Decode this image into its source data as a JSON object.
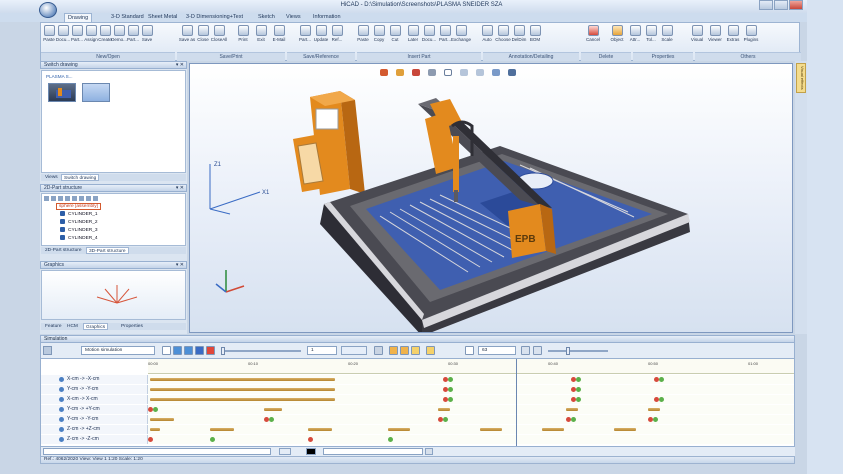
{
  "app": {
    "title": "HiCAD - D:\\Simulation\\Screenshots\\PLASMA SNEIDER SZA",
    "logo_label": "HiCAD"
  },
  "ribbon": {
    "tabs": [
      "Drawing",
      "3-D Standard",
      "Sheet Metal",
      "3-D Dimensioning+Text",
      "Sketch",
      "Views",
      "Information"
    ],
    "active_tab": "Drawing",
    "buttons": [
      "Paste",
      "Docu...",
      "Part...",
      "Assign",
      "Create",
      "Demo...",
      "Part...",
      "Save",
      "Save as",
      "Close",
      "CloseAll",
      "Print",
      "Exit",
      "E-Mail",
      "Part...",
      "Update",
      "Ref...",
      "Paste",
      "Copy",
      "Cut",
      "Later",
      "Docu...",
      "Part...",
      "Exchange",
      "Auto",
      "Choose",
      "DelDim",
      "BOM",
      "Cancel",
      "Object",
      "Attr...",
      "Tol...",
      "Scale",
      "Visual",
      "Viewer",
      "Extras",
      "Plugins"
    ],
    "groups": [
      "New/Open",
      "Save/Print",
      "Save/Reference",
      "Insert Part",
      "Annotation/Detailing",
      "Delete",
      "Properties",
      "Others"
    ]
  },
  "left_panel": {
    "switch_drawing": {
      "header": "Switch drawing",
      "thumb_label": "PLASMA S...",
      "tabs": [
        "Views",
        "Switch drawing"
      ],
      "active_tab": "Switch drawing"
    },
    "part_structure": {
      "header": "2D-Part structure",
      "rows": [
        "sphere [assembly]",
        "CYLINDER_1",
        "CYLINDER_2",
        "CYLINDER_3",
        "CYLINDER_4"
      ],
      "tabs": [
        "2D-Part structure",
        "3D-Part structure"
      ],
      "active_tab": "3D-Part structure"
    },
    "graphics": {
      "header": "Graphics",
      "tabs": [
        "Feature",
        "HCM",
        "Graphics",
        "Properties"
      ],
      "active_tab": "Graphics"
    }
  },
  "viewport": {
    "axis_labels": {
      "z": "Z1",
      "x": "X1"
    },
    "machine_label": "EPB",
    "colors": {
      "frame": "#e38a1e",
      "bed": "#3f5fb0",
      "steel": "#5b5a62"
    }
  },
  "right_strip": {
    "tab_label": "Visual effects"
  },
  "simulation": {
    "header": "Simulation",
    "mode_select": "Motion simulation",
    "step_value": "1",
    "speed_value": "63",
    "ruler_ticks": [
      "00:00",
      "00:10",
      "00:20",
      "00:30",
      "00:40",
      "00:50",
      "01:00",
      "01:10",
      "01:20"
    ],
    "tracks": [
      {
        "label": "X-cm -> -X-cm"
      },
      {
        "label": "Y-cm -> -Y-cm"
      },
      {
        "label": "X-cm -> X-cm"
      },
      {
        "label": "Y-cm -> +Y-cm"
      },
      {
        "label": "Y-cm -> -Y-cm"
      },
      {
        "label": "Z-cm -> +Z-cm"
      },
      {
        "label": "Z-cm -> -Z-cm"
      },
      {
        "label": "Z-cm -> Z-cm"
      }
    ]
  },
  "statusbar": {
    "text": "Ref.: 4062/2020 View: View 1 1:20 Scale: 1:20"
  }
}
